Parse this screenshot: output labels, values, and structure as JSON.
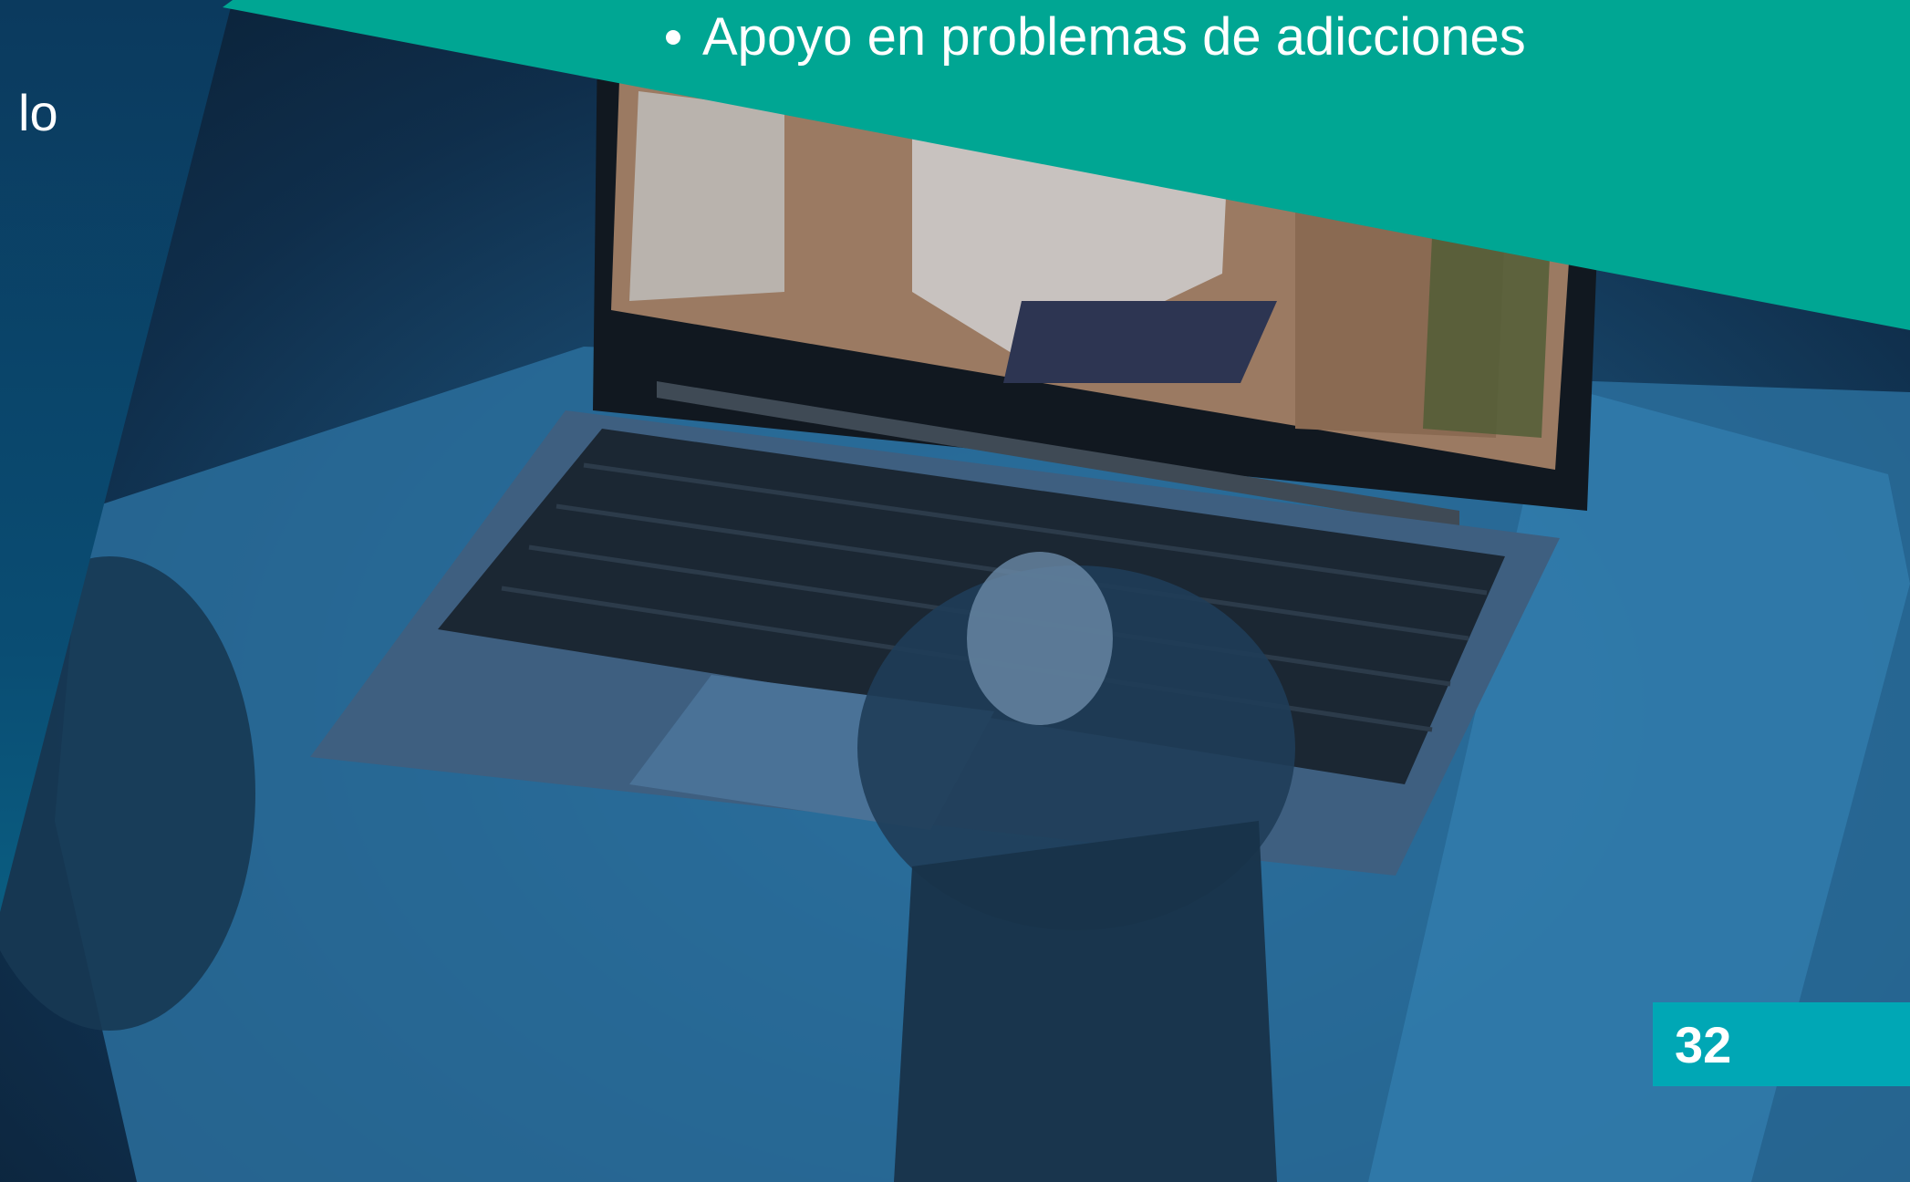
{
  "banner": {
    "bullet_text": "Apoyo en problemas de adicciones"
  },
  "left_panel": {
    "fragment_text": "lo"
  },
  "footer": {
    "page_number": "32"
  },
  "colors": {
    "banner_teal": "#00a693",
    "page_box_teal": "#00a7b5",
    "left_panel_navy": "#0b3a5e"
  },
  "photo": {
    "subject": "person on a video call with a therapist on a laptop"
  }
}
